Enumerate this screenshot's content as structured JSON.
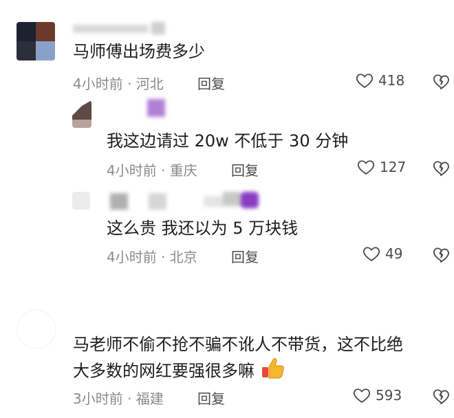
{
  "comments": [
    {
      "text": "马师傅出场费多少",
      "time": "4小时前 · 河北",
      "reply_label": "回复",
      "likes": "418"
    },
    {
      "text": "我这边请过 20w 不低于 30 分钟",
      "time": "4小时前 · 重庆",
      "reply_label": "回复",
      "likes": "127"
    },
    {
      "text": "这么贵  我还以为 5 万块钱",
      "time": "4小时前 · 北京",
      "reply_label": "回复",
      "likes": "49"
    },
    {
      "text_line1": "马老师不偷不抢不骗不讹人不带货，这不比绝",
      "text_line2": "大多数的网红要强很多嘛",
      "time": "3小时前 · 福建",
      "reply_label": "回复",
      "likes": "593",
      "emoji": "thumbs-up-emoji"
    }
  ],
  "icons": {
    "like": "heart-outline-icon",
    "dislike": "broken-heart-icon"
  },
  "colors": {
    "text": "#1d1d1f",
    "meta": "#8a8a8e",
    "icon": "#4b4b4f"
  }
}
